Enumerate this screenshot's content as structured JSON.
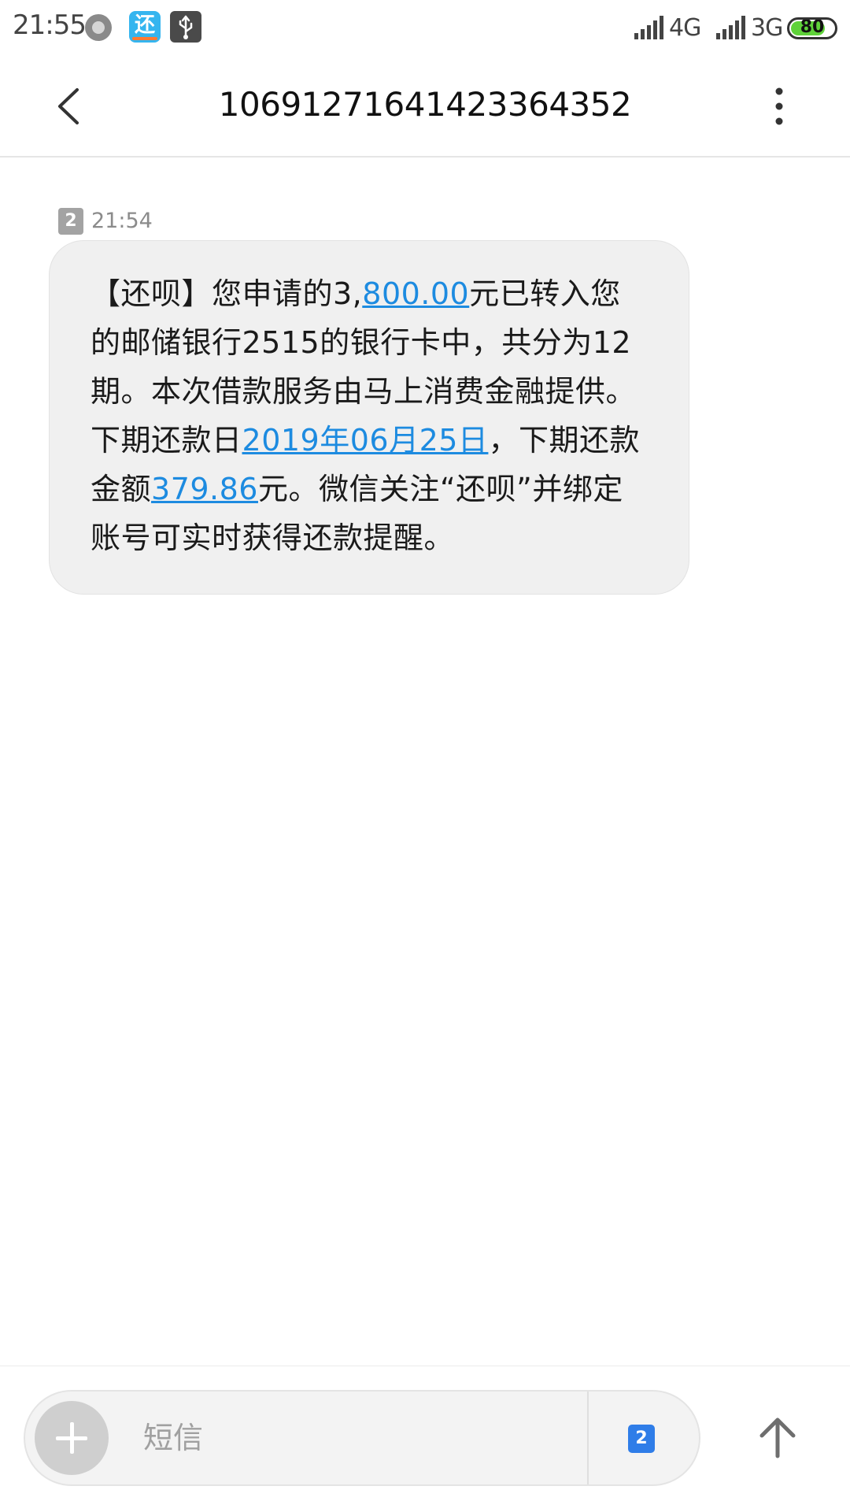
{
  "status_bar": {
    "time": "21:55",
    "app_icon_char": "还",
    "network_1": "4G",
    "network_2": "3G",
    "battery": "80",
    "battery_level": 0.8,
    "icons": [
      "record-icon",
      "app-notification-icon",
      "usb-icon",
      "signal-icon",
      "battery-icon"
    ]
  },
  "header": {
    "title": "10691271641423364352",
    "back_icon": "back-arrow-icon",
    "menu_icon": "more-vert-icon"
  },
  "message": {
    "sim": "2",
    "time": "21:54",
    "segments": [
      {
        "text": "【还呗】您申请的3,",
        "link": false
      },
      {
        "text": "800.00",
        "link": true
      },
      {
        "text": "元已转入您的邮储银行2515的银行卡中，共分为12期。本次借款服务由马上消费金融提供。下期还款日",
        "link": false
      },
      {
        "text": "2019年06月25日",
        "link": true
      },
      {
        "text": "，下期还款金额",
        "link": false
      },
      {
        "text": "379.86",
        "link": true
      },
      {
        "text": "元。微信关注“还呗”并绑定账号可实时获得还款提醒。",
        "link": false
      }
    ]
  },
  "compose": {
    "placeholder": "短信",
    "sim": "2",
    "add_icon": "plus-icon",
    "send_icon": "send-arrow-up-icon"
  },
  "colors": {
    "link": "#1d8be0",
    "bubble": "#f0f0f0",
    "sim_active": "#2f7de8",
    "battery": "#5fd23a"
  }
}
